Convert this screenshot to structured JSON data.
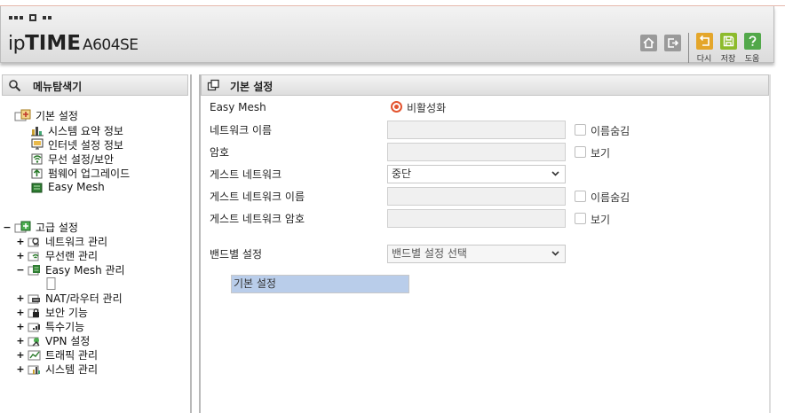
{
  "header": {
    "logo_prefix": "ip",
    "logo_main": "TIME",
    "logo_model": "A604SE",
    "buttons": {
      "home_icon": "home-icon",
      "logout_icon": "logout-icon",
      "reset_label": "다시",
      "save_label": "저장",
      "help_label": "도움"
    }
  },
  "sidebar": {
    "title": "메뉴탐색기",
    "basic": {
      "label": "기본 설정",
      "items": [
        "시스템 요약 정보",
        "인터넷 설정 정보",
        "무선 설정/보안",
        "펌웨어 업그레이드",
        "Easy Mesh"
      ]
    },
    "advanced": {
      "expander": "−",
      "label": "고급 설정",
      "items": [
        {
          "expander": "+",
          "label": "네트워크 관리"
        },
        {
          "expander": "+",
          "label": "무선랜 관리"
        },
        {
          "expander": "−",
          "label": "Easy Mesh 관리"
        },
        {
          "expander": "",
          "label": "기본 설정",
          "selected": true
        },
        {
          "expander": "+",
          "label": "NAT/라우터 관리"
        },
        {
          "expander": "+",
          "label": "보안 기능"
        },
        {
          "expander": "+",
          "label": "특수기능"
        },
        {
          "expander": "+",
          "label": "VPN 설정"
        },
        {
          "expander": "+",
          "label": "트래픽 관리"
        },
        {
          "expander": "+",
          "label": "시스템 관리"
        }
      ]
    }
  },
  "main": {
    "title": "기본 설정",
    "easy_mesh": {
      "label": "Easy Mesh",
      "option": "비활성화"
    },
    "network_name": {
      "label": "네트워크 이름",
      "value": "",
      "hide_label": "이름숨김"
    },
    "password": {
      "label": "암호",
      "value": "",
      "show_label": "보기"
    },
    "guest_network": {
      "label": "게스트 네트워크",
      "value": "중단"
    },
    "guest_network_name": {
      "label": "게스트 네트워크 이름",
      "value": "",
      "hide_label": "이름숨김"
    },
    "guest_network_password": {
      "label": "게스트 네트워크 암호",
      "value": "",
      "show_label": "보기"
    },
    "band_setting": {
      "label": "밴드별 설정",
      "value": "밴드별 설정 선택"
    }
  },
  "colors": {
    "radio_accent": "#e3542f",
    "selected_bg": "#b9cdea",
    "reset_button": "#e4a62a",
    "save_button": "#8dbb2c",
    "help_button": "#52a84a"
  }
}
